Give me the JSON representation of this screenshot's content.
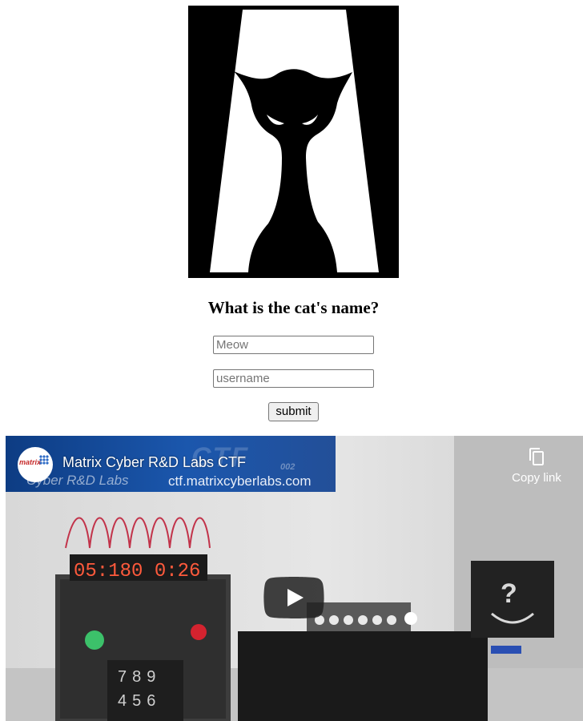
{
  "quiz": {
    "question": "What is the cat's name?",
    "answer_placeholder": "Meow",
    "username_placeholder": "username",
    "submit_label": "submit"
  },
  "video": {
    "title": "Matrix Cyber R&D Labs CTF",
    "copy_link_label": "Copy link",
    "channel_logo_text": "matrix",
    "banner": {
      "ctf_text": "CTF",
      "year_text": "002",
      "subtitle": "Cyber R&D Labs",
      "url": "ctf.matrixcyberlabs.com"
    },
    "scene": {
      "timer_display": "05:180 0:26",
      "keypad_rows": [
        "789",
        "456"
      ],
      "box_symbol": "?"
    }
  },
  "icons": {
    "copy": "copy-icon",
    "play": "play-icon"
  },
  "colors": {
    "youtube_play": "#212121",
    "banner_blue": "#1b57ad",
    "timer_red": "#ff5a3c"
  }
}
